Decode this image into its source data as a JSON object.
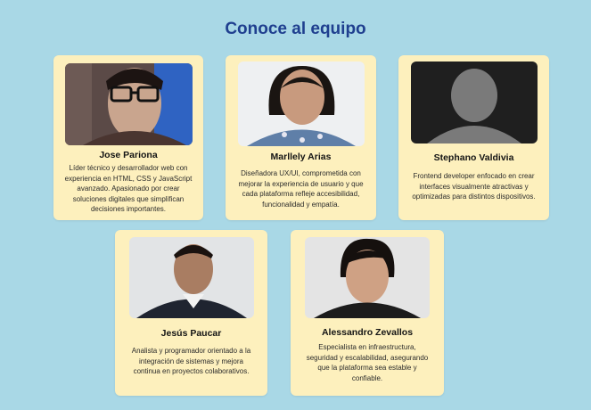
{
  "section": {
    "title": "Conoce al equipo"
  },
  "team": [
    {
      "name": "Jose Pariona",
      "description": "Líder técnico y desarrollador web con experiencia en HTML, CSS y JavaScript avanzado. Apasionado por crear soluciones digitales que simplifican decisiones importantes."
    },
    {
      "name": "Marllely Arias",
      "description": "Diseñadora UX/UI, comprometida con mejorar la experiencia de usuario y que cada plataforma refleje accesibilidad, funcionalidad y empatía."
    },
    {
      "name": "Stephano Valdivia",
      "description": "Frontend developer enfocado en crear interfaces visualmente atractivas y optimizadas para distintos dispositivos."
    },
    {
      "name": "Jesús Paucar",
      "description": "Analista y programador orientado a la integración de sistemas y mejora continua en proyectos colaborativos."
    },
    {
      "name": "Alessandro Zevallos",
      "description": "Especialista en infraestructura, seguridad y escalabilidad, asegurando que la plataforma sea estable y confiable."
    }
  ]
}
